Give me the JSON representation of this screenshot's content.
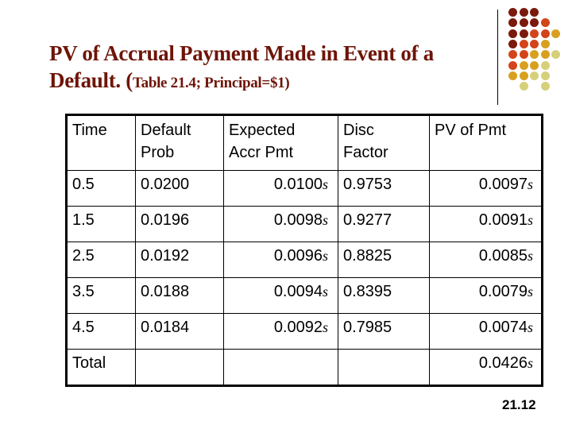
{
  "slide": {
    "title_main": "PV of Accrual Payment Made in Event of a Default. (",
    "title_sub": "Table 21.4; Principal=$1)",
    "page_number": "21.12",
    "decoration": {
      "name": "dot-grid-logo",
      "colors": {
        "dark_red": "#7a1a0c",
        "red_orange": "#d4441a",
        "gold": "#d9a020",
        "pale_olive": "#d6d07a"
      }
    }
  },
  "table": {
    "headers": [
      "Time",
      "Default Prob",
      "Expected Accr Pmt",
      "Disc Factor",
      "PV of Pmt"
    ],
    "header_lines": [
      [
        "Time"
      ],
      [
        "Default",
        "Prob"
      ],
      [
        "Expected",
        "Accr Pmt"
      ],
      [
        "Disc",
        "Factor"
      ],
      [
        "PV of Pmt"
      ]
    ],
    "unit_symbol": "s",
    "rows": [
      {
        "time": "0.5",
        "default_prob": "0.0200",
        "expected_accr_pmt": "0.0100",
        "disc_factor": "0.9753",
        "pv_of_pmt": "0.0097"
      },
      {
        "time": "1.5",
        "default_prob": "0.0196",
        "expected_accr_pmt": "0.0098",
        "disc_factor": "0.9277",
        "pv_of_pmt": "0.0091"
      },
      {
        "time": "2.5",
        "default_prob": "0.0192",
        "expected_accr_pmt": "0.0096",
        "disc_factor": "0.8825",
        "pv_of_pmt": "0.0085"
      },
      {
        "time": "3.5",
        "default_prob": "0.0188",
        "expected_accr_pmt": "0.0094",
        "disc_factor": "0.8395",
        "pv_of_pmt": "0.0079"
      },
      {
        "time": "4.5",
        "default_prob": "0.0184",
        "expected_accr_pmt": "0.0092",
        "disc_factor": "0.7985",
        "pv_of_pmt": "0.0074"
      }
    ],
    "total": {
      "label": "Total",
      "pv_of_pmt": "0.0426"
    }
  }
}
